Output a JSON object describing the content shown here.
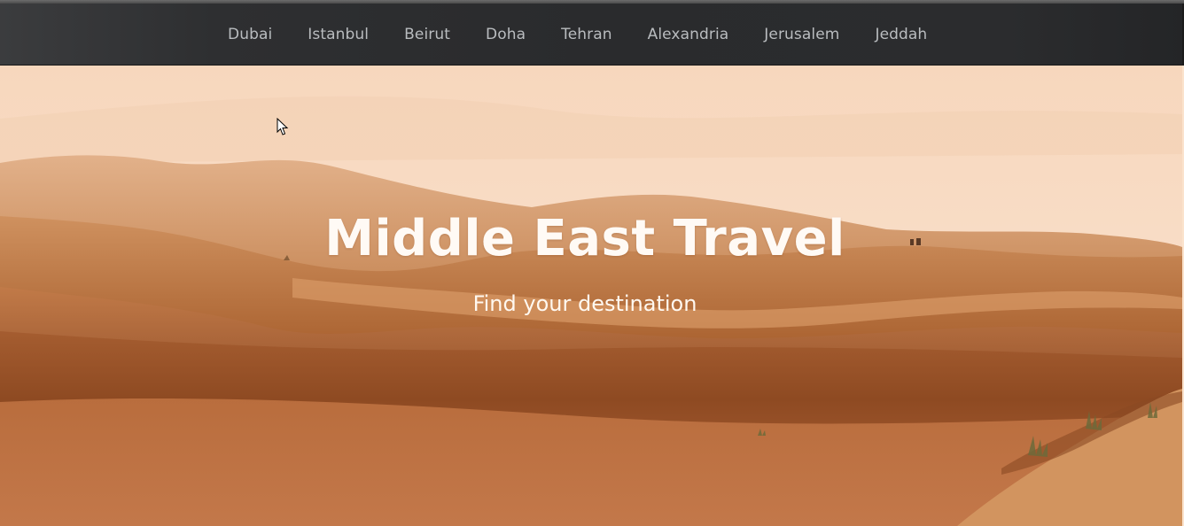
{
  "nav": {
    "items": [
      {
        "label": "Dubai"
      },
      {
        "label": "Istanbul"
      },
      {
        "label": "Beirut"
      },
      {
        "label": "Doha"
      },
      {
        "label": "Tehran"
      },
      {
        "label": "Alexandria"
      },
      {
        "label": "Jerusalem"
      },
      {
        "label": "Jeddah"
      }
    ]
  },
  "hero": {
    "title": "Middle East Travel",
    "subtitle": "Find your destination",
    "image": "desert-dunes-photo"
  },
  "colors": {
    "navbar_bg": "#2b2c2e",
    "nav_text": "#b9bcbf",
    "hero_text": "#fffaf5",
    "sky": "#f6d9bf",
    "sand_dark": "#8a4a22",
    "sand_light": "#c98552"
  },
  "cursor": {
    "icon": "mouse-pointer-icon"
  }
}
